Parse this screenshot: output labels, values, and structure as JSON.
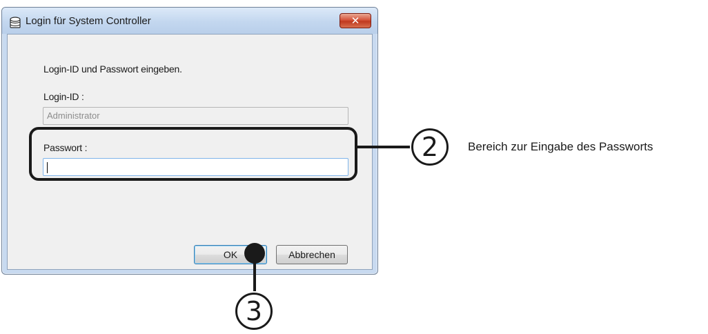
{
  "window": {
    "title": "Login für System Controller",
    "close_label": "✕"
  },
  "form": {
    "instruction": "Login-ID und Passwort eingeben.",
    "login_id_label": "Login-ID :",
    "login_id_value": "Administrator",
    "password_label": "Passwort :",
    "password_value": ""
  },
  "buttons": {
    "ok_label": "OK",
    "cancel_label": "Abbrechen"
  },
  "callouts": {
    "password_area": {
      "number": "2",
      "text": "Bereich zur Eingabe des Passworts"
    },
    "ok_button": {
      "number": "3"
    }
  }
}
